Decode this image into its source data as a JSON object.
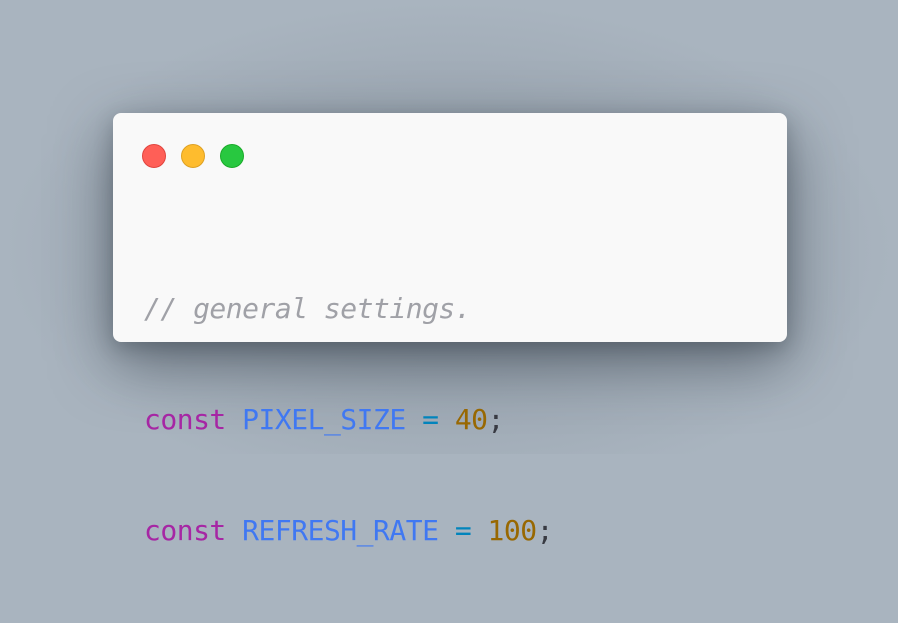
{
  "window": {
    "controls": {
      "close_color": "#ff5f57",
      "minimize_color": "#febc2e",
      "maximize_color": "#28c840"
    }
  },
  "code": {
    "comment": "// general settings.",
    "lines": [
      {
        "keyword": "const",
        "name": "PIXEL_SIZE",
        "operator": "=",
        "value": "40",
        "end": ";"
      },
      {
        "keyword": "const",
        "name": "REFRESH_RATE",
        "operator": "=",
        "value": "100",
        "end": ";"
      }
    ]
  },
  "colors": {
    "comment": "#a0a1a7",
    "keyword": "#a626a4",
    "identifier": "#4078f2",
    "operator": "#0184bc",
    "number": "#986801"
  }
}
